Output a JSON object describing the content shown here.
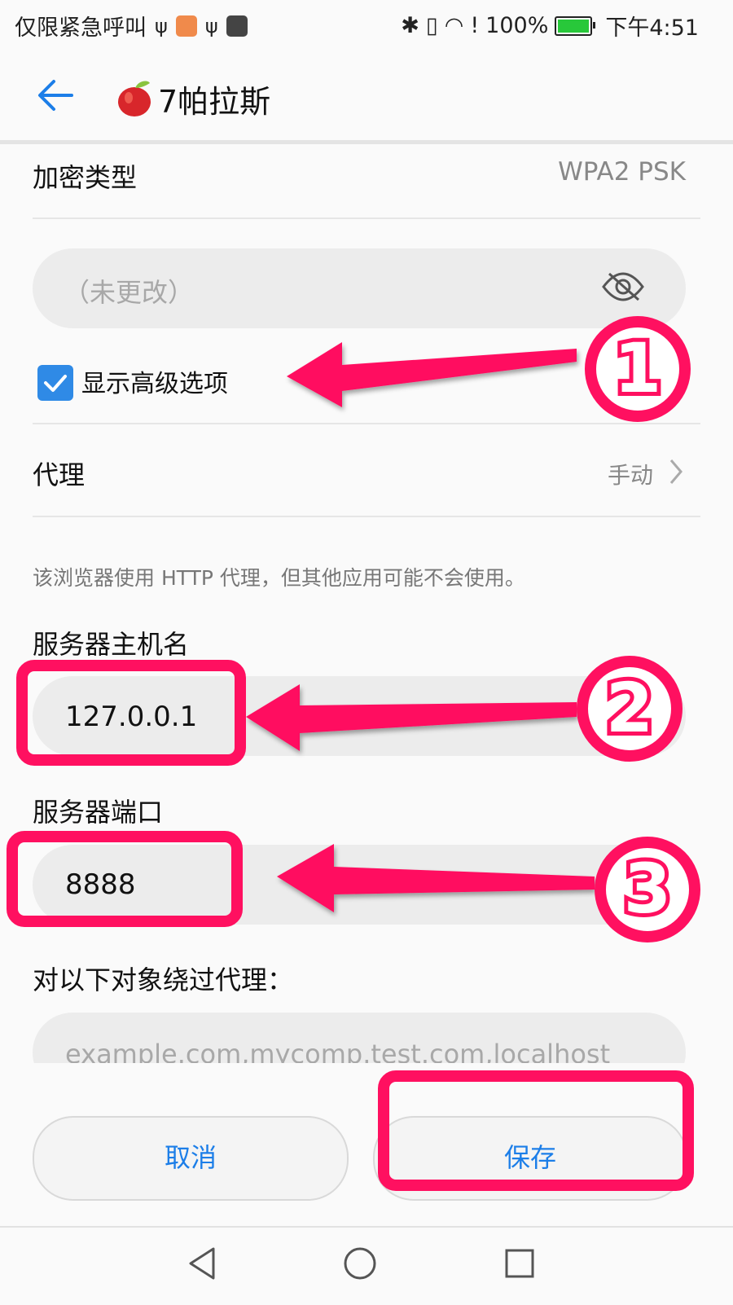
{
  "status_bar": {
    "left_text": "仅限紧急呼叫",
    "battery_text": "100%",
    "time": "下午4:51"
  },
  "app_bar": {
    "back_icon": "arrow-left-icon",
    "title": "7帕拉斯"
  },
  "encryption": {
    "label": "加密类型",
    "value": "WPA2 PSK"
  },
  "password": {
    "placeholder": "（未更改）",
    "visibility_icon": "eye-off-icon"
  },
  "advanced_options": {
    "label": "显示高级选项",
    "checked": true
  },
  "proxy": {
    "label": "代理",
    "value": "手动",
    "hint": "该浏览器使用 HTTP 代理，但其他应用可能不会使用。"
  },
  "hostname": {
    "label": "服务器主机名",
    "value": "127.0.0.1"
  },
  "port": {
    "label": "服务器端口",
    "value": "8888"
  },
  "bypass": {
    "label": "对以下对象绕过代理：",
    "placeholder": "example.com,mycomp.test.com,localhost"
  },
  "actions": {
    "cancel": "取消",
    "save": "保存"
  },
  "annotations": [
    "1",
    "2",
    "3"
  ],
  "colors": {
    "accent": "#1c7ee8",
    "annotation": "#ff1060",
    "checkbox": "#2f8ae6"
  }
}
